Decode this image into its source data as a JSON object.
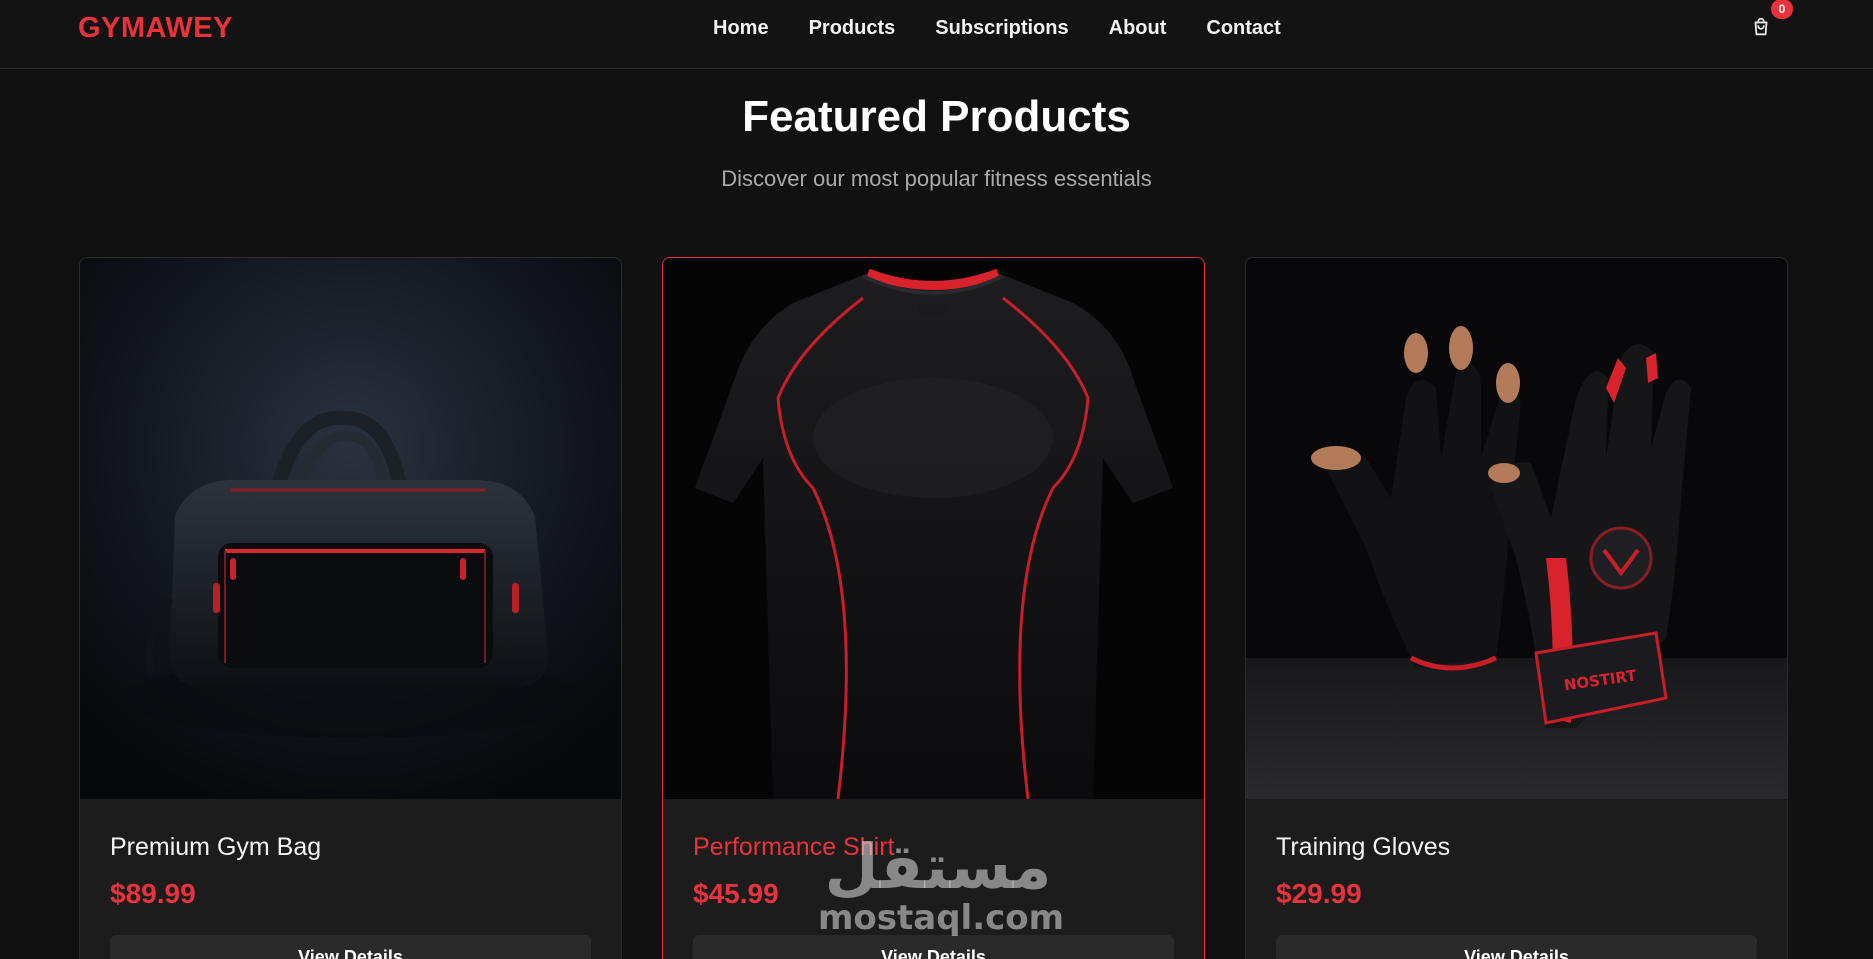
{
  "header": {
    "logo": "GYMAWEY",
    "nav": [
      "Home",
      "Products",
      "Subscriptions",
      "About",
      "Contact"
    ],
    "cart_count": "0"
  },
  "featured": {
    "title": "Featured Products",
    "subtitle": "Discover our most popular fitness essentials"
  },
  "products": [
    {
      "name": "Premium Gym Bag",
      "price": "$89.99",
      "button": "View Details"
    },
    {
      "name": "Performance Shirt",
      "price": "$45.99",
      "button": "View Details"
    },
    {
      "name": "Training Gloves",
      "price": "$29.99",
      "button": "View Details"
    }
  ],
  "watermark": {
    "arabic": "مستقل",
    "latin": "mostaql.com"
  },
  "colors": {
    "accent": "#e8323c",
    "background": "#111111",
    "card": "#1c1c1c"
  },
  "icons": {
    "cart": "shopping-bag-icon"
  }
}
